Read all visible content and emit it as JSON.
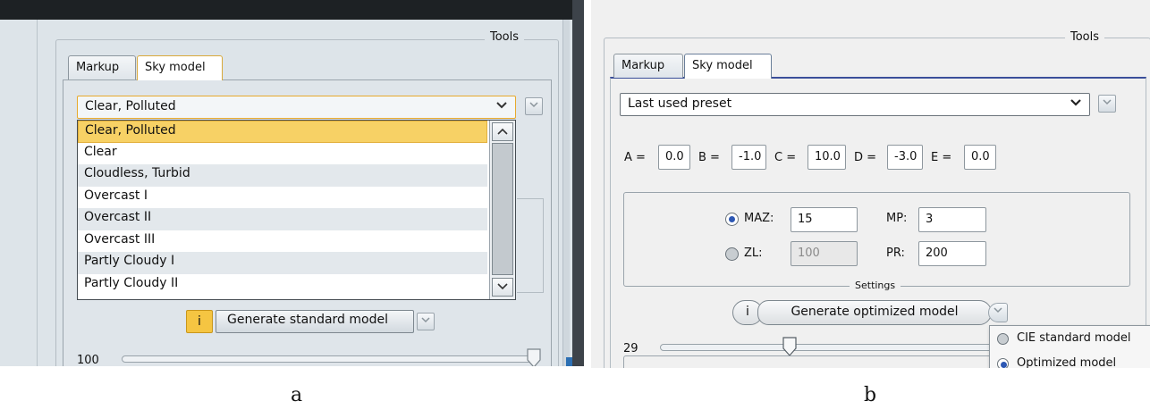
{
  "panel_a": {
    "group_title": "Tools",
    "tabs": [
      {
        "label": "Markup",
        "active": false
      },
      {
        "label": "Sky model",
        "active": true
      }
    ],
    "preset_combo": {
      "value": "Clear, Polluted"
    },
    "dropdown_options": [
      "Clear, Polluted",
      "Clear",
      "Cloudless, Turbid",
      "Overcast I",
      "Overcast II",
      "Overcast III",
      "Partly Cloudy I",
      "Partly Cloudy II"
    ],
    "selected_option": "Clear, Polluted",
    "info_button": "i",
    "generate_button": "Generate standard model",
    "slider": {
      "value_label": "100",
      "value": 100,
      "min": 0,
      "max": 100
    }
  },
  "panel_b": {
    "group_title": "Tools",
    "tabs": [
      {
        "label": "Markup",
        "active": false
      },
      {
        "label": "Sky model",
        "active": true
      }
    ],
    "preset_combo": {
      "value": "Last used preset"
    },
    "coefficients": [
      {
        "label": "A =",
        "value": "0.0"
      },
      {
        "label": "B =",
        "value": "-1.0"
      },
      {
        "label": "C =",
        "value": "10.0"
      },
      {
        "label": "D =",
        "value": "-3.0"
      },
      {
        "label": "E =",
        "value": "0.0"
      }
    ],
    "settings": {
      "title": "Settings",
      "maz": {
        "label": "MAZ:",
        "value": "15",
        "selected": true
      },
      "mp": {
        "label": "MP:",
        "value": "3"
      },
      "zl": {
        "label": "ZL:",
        "value": "100",
        "selected": false
      },
      "pr": {
        "label": "PR:",
        "value": "200"
      }
    },
    "info_button": "i",
    "generate_button": "Generate optimized model",
    "slider": {
      "value_label": "29",
      "value": 29,
      "min": 0,
      "max": 100
    },
    "menu": [
      {
        "label": "CIE standard model",
        "selected": false
      },
      {
        "label": "Optimized model",
        "selected": true
      }
    ]
  },
  "captions": {
    "a": "a",
    "b": "b"
  },
  "colors": {
    "accent_a": "#f5c542",
    "selection_a": "#f7d165",
    "accent_b": "#2c57b3"
  },
  "icons": {
    "combo_arrow": "chevron-down-icon",
    "small_button": "dropdown-arrow-icon",
    "slider_handle": "slider-handle-icon"
  }
}
